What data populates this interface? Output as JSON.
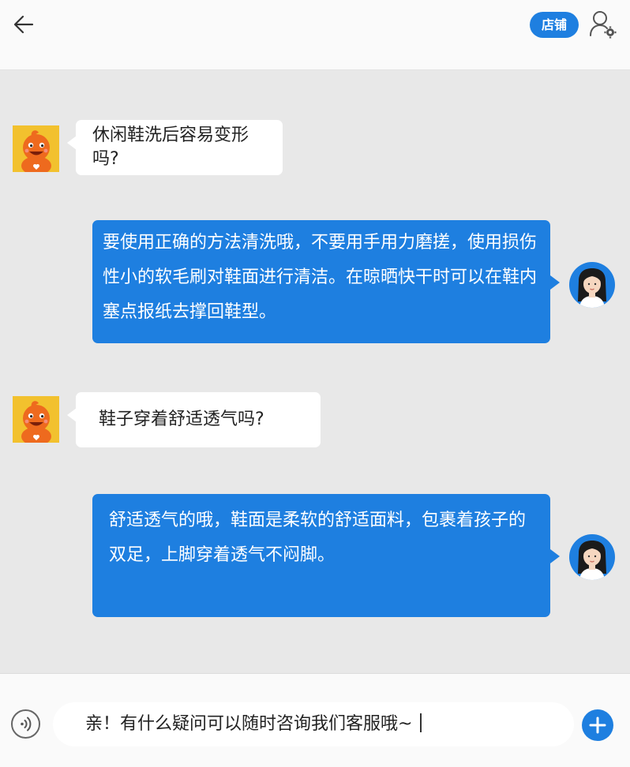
{
  "header": {
    "shop_label": "店铺",
    "back_icon": "arrow-left-icon",
    "user_settings_icon": "user-settings-icon"
  },
  "messages": [
    {
      "sender": "customer",
      "avatar_icon": "orange-mascot-icon",
      "text": "休闲鞋洗后容易变形吗?"
    },
    {
      "sender": "service",
      "avatar_icon": "woman-agent-icon",
      "text": "要使用正确的方法清洗哦，不要用手用力磨搓，使用损伤性小的软毛刷对鞋面进行清洁。在晾晒快干时可以在鞋内塞点报纸去撑回鞋型。"
    },
    {
      "sender": "customer",
      "avatar_icon": "orange-mascot-icon",
      "text": "鞋子穿着舒适透气吗?"
    },
    {
      "sender": "service",
      "avatar_icon": "woman-agent-icon",
      "text": "舒适透气的哦，鞋面是柔软的舒适面料，包裹着孩子的双足，上脚穿着透气不闷脚。"
    }
  ],
  "footer": {
    "input_text": "亲！有什么疑问可以随时咨询我们客服哦~",
    "voice_icon": "voice-icon",
    "plus_icon": "plus-icon"
  },
  "colors": {
    "accent": "#1e7fe0",
    "chat_background": "#e8e8e8",
    "header_background": "#fafafa",
    "mascot_background": "#f2c12e"
  }
}
